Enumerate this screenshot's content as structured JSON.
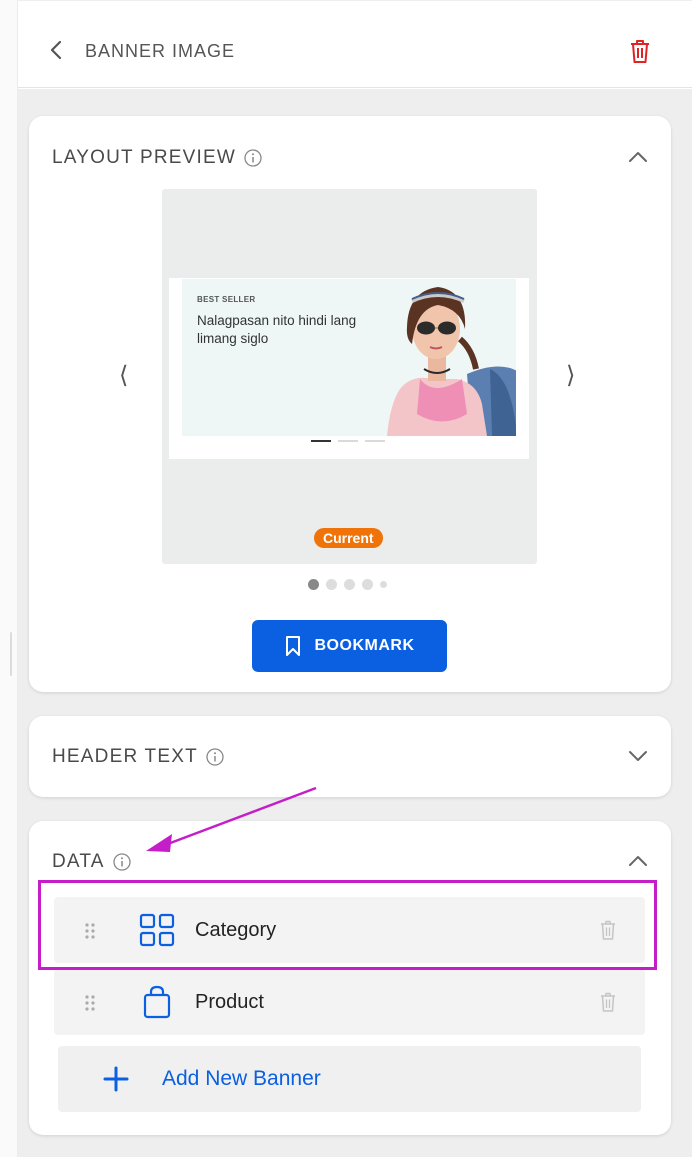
{
  "header": {
    "title": "BANNER IMAGE",
    "back_icon": "chevron-left-icon",
    "delete_icon": "trash-icon",
    "delete_color": "#e02424"
  },
  "layout_preview": {
    "title": "LAYOUT PREVIEW",
    "banner": {
      "eyebrow": "BEST SELLER",
      "headline": "Nalagpasan nito hindi lang limang siglo"
    },
    "badge": "Current",
    "badge_color": "#f07309",
    "prev_arrow": "⟨",
    "next_arrow": "⟩",
    "active_page": 1,
    "page_count": 5,
    "bookmark_label": "BOOKMARK",
    "accent": "#0a60e0"
  },
  "header_text": {
    "title": "HEADER TEXT"
  },
  "data_section": {
    "title": "DATA",
    "items": [
      {
        "label": "Category",
        "icon": "grid-icon"
      },
      {
        "label": "Product",
        "icon": "shopping-bag-icon"
      }
    ],
    "add_label": "Add New Banner"
  },
  "annotation": {
    "color": "#c51ec9"
  }
}
